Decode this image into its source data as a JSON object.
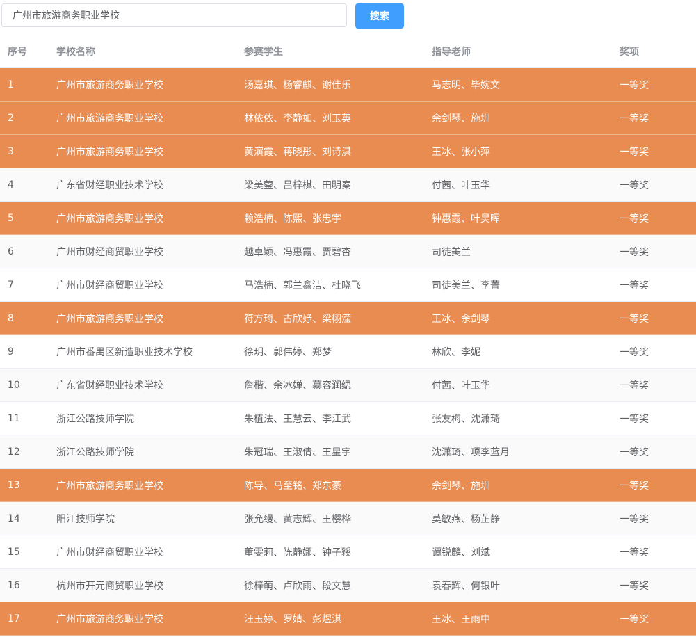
{
  "search": {
    "value": "广州市旅游商务职业学校",
    "button_label": "搜索"
  },
  "colors": {
    "highlight_row": "#e88c52",
    "search_button": "#409eff",
    "striped_row": "#fafafa"
  },
  "table": {
    "headers": {
      "index": "序号",
      "school": "学校名称",
      "students": "参赛学生",
      "teachers": "指导老师",
      "award": "奖项"
    },
    "rows": [
      {
        "index": "1",
        "school": "广州市旅游商务职业学校",
        "students": "汤嘉琪、杨睿麒、谢佳乐",
        "teachers": "马志明、毕婉文",
        "award": "一等奖",
        "highlighted": true
      },
      {
        "index": "2",
        "school": "广州市旅游商务职业学校",
        "students": "林依依、李静如、刘玉英",
        "teachers": "余剑琴、施圳",
        "award": "一等奖",
        "highlighted": true
      },
      {
        "index": "3",
        "school": "广州市旅游商务职业学校",
        "students": "黄演霞、蒋晓彤、刘诗淇",
        "teachers": "王冰、张小萍",
        "award": "一等奖",
        "highlighted": true
      },
      {
        "index": "4",
        "school": "广东省财经职业技术学校",
        "students": "梁美蓥、吕梓棋、田明秦",
        "teachers": "付茜、叶玉华",
        "award": "一等奖",
        "highlighted": false
      },
      {
        "index": "5",
        "school": "广州市旅游商务职业学校",
        "students": "赖浩楠、陈熙、张忠宇",
        "teachers": "钟惠霞、叶昊晖",
        "award": "一等奖",
        "highlighted": true
      },
      {
        "index": "6",
        "school": "广州市财经商贸职业学校",
        "students": "越卓颖、冯惠霞、贾碧杏",
        "teachers": "司徒美兰",
        "award": "一等奖",
        "highlighted": false
      },
      {
        "index": "7",
        "school": "广州市财经商贸职业学校",
        "students": "马浩楠、郭兰鑫洁、杜晓飞",
        "teachers": "司徒美兰、李菁",
        "award": "一等奖",
        "highlighted": false
      },
      {
        "index": "8",
        "school": "广州市旅游商务职业学校",
        "students": "符方琦、古欣妤、梁栩滢",
        "teachers": "王冰、余剑琴",
        "award": "一等奖",
        "highlighted": true
      },
      {
        "index": "9",
        "school": "广州市番禺区新造职业技术学校",
        "students": "徐玥、郭伟婷、郑梦",
        "teachers": "林欣、李妮",
        "award": "一等奖",
        "highlighted": false
      },
      {
        "index": "10",
        "school": "广东省财经职业技术学校",
        "students": "詹楷、余冰婵、慕容润缌",
        "teachers": "付茜、叶玉华",
        "award": "一等奖",
        "highlighted": false
      },
      {
        "index": "11",
        "school": "浙江公路技师学院",
        "students": "朱植法、王慧云、李江武",
        "teachers": "张友梅、沈潇琦",
        "award": "一等奖",
        "highlighted": false
      },
      {
        "index": "12",
        "school": "浙江公路技师学院",
        "students": "朱冠瑞、王淑倩、王星宇",
        "teachers": "沈潇琦、项李蓝月",
        "award": "一等奖",
        "highlighted": false
      },
      {
        "index": "13",
        "school": "广州市旅游商务职业学校",
        "students": "陈导、马至铭、郑东豪",
        "teachers": "余剑琴、施圳",
        "award": "一等奖",
        "highlighted": true
      },
      {
        "index": "14",
        "school": "阳江技师学院",
        "students": "张允缦、黄志辉、王樱桦",
        "teachers": "莫敏燕、杨芷静",
        "award": "一等奖",
        "highlighted": false
      },
      {
        "index": "15",
        "school": "广州市财经商贸职业学校",
        "students": "董雯莉、陈静娜、钟子豯",
        "teachers": "谭锐麟、刘斌",
        "award": "一等奖",
        "highlighted": false
      },
      {
        "index": "16",
        "school": "杭州市开元商贸职业学校",
        "students": "徐梓萌、卢欣雨、段文慧",
        "teachers": "袁春辉、何银叶",
        "award": "一等奖",
        "highlighted": false
      },
      {
        "index": "17",
        "school": "广州市旅游商务职业学校",
        "students": "汪玉婷、罗婧、彭煜淇",
        "teachers": "王冰、王雨中",
        "award": "一等奖",
        "highlighted": true
      }
    ]
  }
}
